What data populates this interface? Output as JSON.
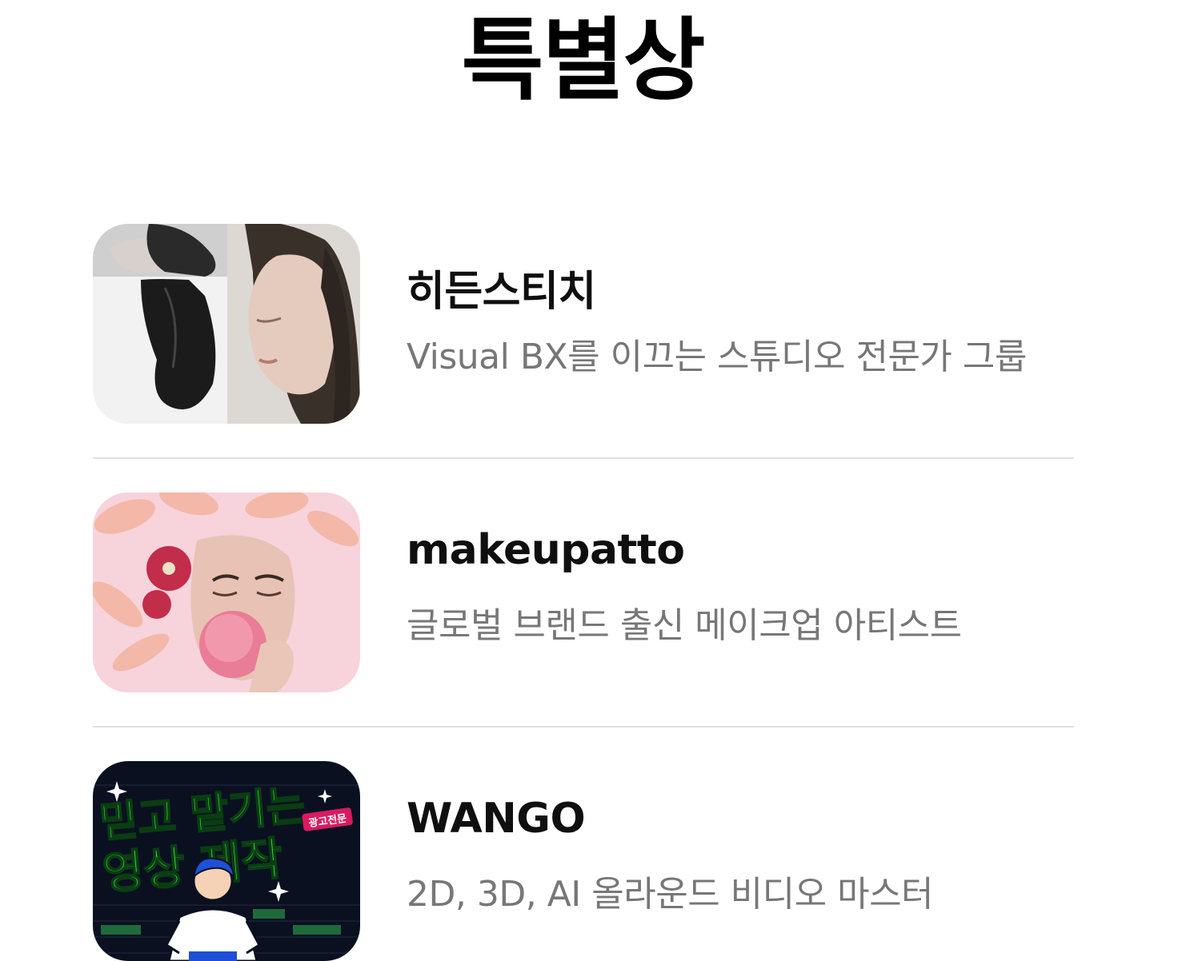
{
  "page": {
    "title": "특별상"
  },
  "entries": [
    {
      "name": "히든스티치",
      "description": "Visual BX를 이끄는 스튜디오 전문가 그룹"
    },
    {
      "name": "makeupatto",
      "description": "글로벌 브랜드 출신 메이크업 아티스트"
    },
    {
      "name": "WANGO",
      "description": "2D, 3D, AI 올라운드 비디오 마스터",
      "thumbnail_text": {
        "line1": "믿고 맡기는",
        "line2": "영상 제작",
        "badge": "광고전문"
      }
    }
  ],
  "colors": {
    "title": "#000000",
    "name": "#0f0f0f",
    "description": "#777777",
    "divider": "#e1e1e1",
    "wango_green": "#39e639",
    "wango_bg": "#0b1020",
    "makeup_pink": "#f7d3dc"
  }
}
